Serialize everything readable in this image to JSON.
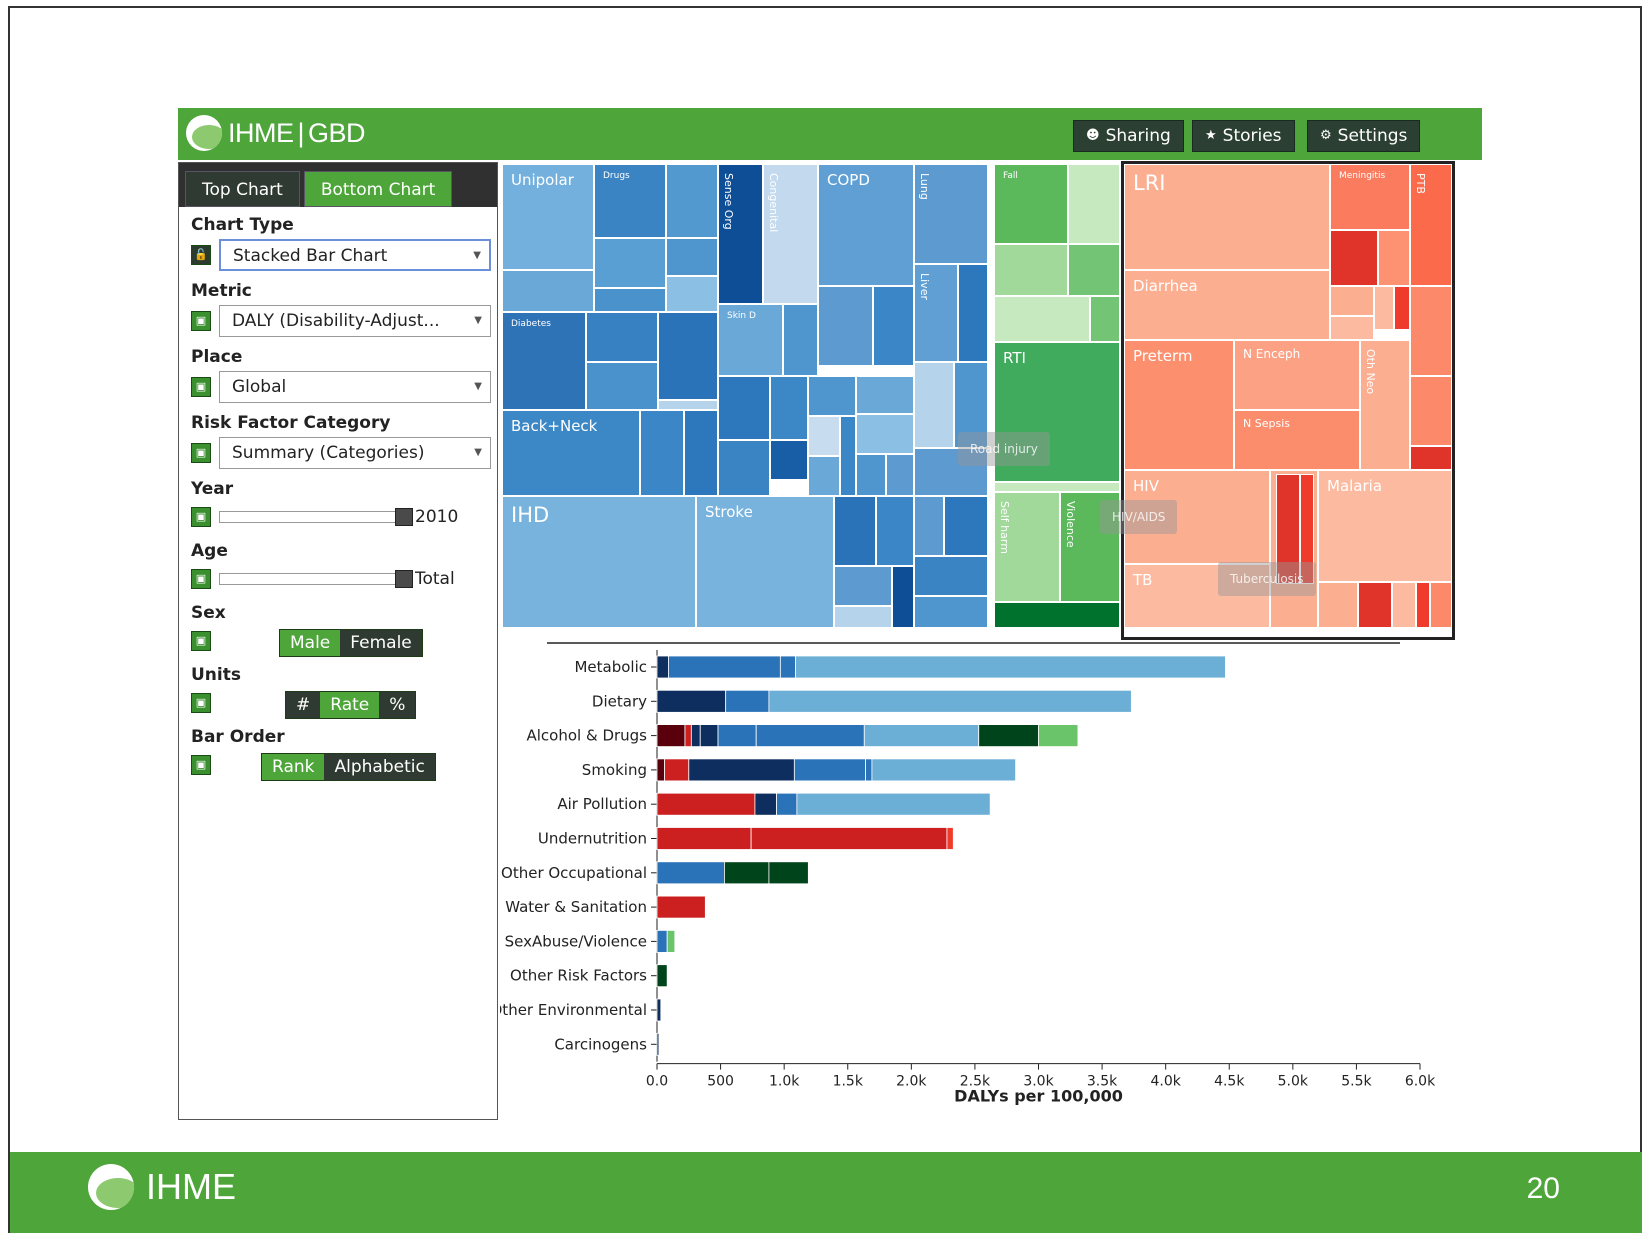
{
  "app": {
    "logo_left": "IHME",
    "logo_right": "GBD"
  },
  "header_buttons": [
    {
      "label": "Sharing",
      "icon": "user-icon"
    },
    {
      "label": "Stories",
      "icon": "star-icon"
    },
    {
      "label": "Settings",
      "icon": "gear-icon"
    }
  ],
  "sidebar": {
    "tabs": [
      {
        "label": "Top Chart",
        "active": false
      },
      {
        "label": "Bottom Chart",
        "active": true
      }
    ],
    "chart_type": {
      "label": "Chart Type",
      "value": "Stacked Bar Chart"
    },
    "metric": {
      "label": "Metric",
      "value": "DALY (Disability-Adjust..."
    },
    "place": {
      "label": "Place",
      "value": "Global"
    },
    "risk_factor_category": {
      "label": "Risk Factor Category",
      "value": "Summary (Categories)"
    },
    "year": {
      "label": "Year",
      "value": "2010"
    },
    "age": {
      "label": "Age",
      "value": "Total"
    },
    "sex": {
      "label": "Sex",
      "options": [
        "Male",
        "Female"
      ]
    },
    "units": {
      "label": "Units",
      "options": [
        "#",
        "Rate",
        "%"
      ],
      "selected": "Rate"
    },
    "bar_order": {
      "label": "Bar Order",
      "options": [
        "Rank",
        "Alphabetic"
      ],
      "selected": "Rank"
    }
  },
  "treemap": {
    "labels": {
      "unipolar": "Unipolar",
      "drugs": "Drugs",
      "sense_org": "Sense Org",
      "congenital": "Congenital",
      "copd": "COPD",
      "lung": "Lung",
      "liver": "Liver",
      "diabetes": "Diabetes",
      "skin_d": "Skin D",
      "back_neck": "Back+Neck",
      "ihd": "IHD",
      "stroke": "Stroke",
      "fall": "Fall",
      "rti": "RTI",
      "self_harm": "Self harm",
      "violence": "Violence",
      "lri": "LRI",
      "meningitis": "Meningitis",
      "ptb": "PTB",
      "diarrhea": "Diarrhea",
      "preterm": "Preterm",
      "n_enceph": "N Enceph",
      "n_sepsis": "N Sepsis",
      "oth_neo": "Oth Neo",
      "hiv": "HIV",
      "malaria": "Malaria",
      "tb": "TB"
    },
    "tooltips": {
      "road_injury": "Road injury",
      "hiv_aids": "HIV/AIDS",
      "tuberculosis": "Tuberculosis"
    }
  },
  "chart_data": {
    "type": "bar",
    "orientation": "horizontal",
    "stacked": true,
    "xlabel": "DALYs per 100,000",
    "xlim": [
      0,
      6000
    ],
    "xticks": [
      "0.0",
      "500",
      "1.0k",
      "1.5k",
      "2.0k",
      "2.5k",
      "3.0k",
      "3.5k",
      "4.0k",
      "4.5k",
      "5.0k",
      "5.5k",
      "6.0k"
    ],
    "categories": [
      "Metabolic",
      "Dietary",
      "Alcohol & Drugs",
      "Smoking",
      "Air Pollution",
      "Undernutrition",
      "Other Occupational",
      "Water & Sanitation",
      "SexAbuse/Violence",
      "Other Risk Factors",
      "Other Environmental",
      "Carcinogens"
    ],
    "segments": [
      [
        [
          90,
          "#0d2e5e"
        ],
        [
          880,
          "#2b73b8"
        ],
        [
          120,
          "#2b73b8"
        ],
        [
          3380,
          "#6baed6"
        ]
      ],
      [
        [
          540,
          "#0d2e5e"
        ],
        [
          340,
          "#2b73b8"
        ],
        [
          2850,
          "#6baed6"
        ]
      ],
      [
        [
          220,
          "#5a000d"
        ],
        [
          50,
          "#cc2020"
        ],
        [
          70,
          "#0d2e5e"
        ],
        [
          140,
          "#0d2e5e"
        ],
        [
          300,
          "#2b73b8"
        ],
        [
          850,
          "#2b73b8"
        ],
        [
          900,
          "#6baed6"
        ],
        [
          470,
          "#00441b"
        ],
        [
          310,
          "#6ac46a"
        ]
      ],
      [
        [
          60,
          "#5a000d"
        ],
        [
          190,
          "#cc2020"
        ],
        [
          830,
          "#0d2e5e"
        ],
        [
          560,
          "#2b73b8"
        ],
        [
          50,
          "#2b73b8"
        ],
        [
          1130,
          "#6baed6"
        ]
      ],
      [
        [
          770,
          "#cc2020"
        ],
        [
          170,
          "#0d2e5e"
        ],
        [
          160,
          "#2b73b8"
        ],
        [
          1520,
          "#6baed6"
        ]
      ],
      [
        [
          740,
          "#cc2020"
        ],
        [
          1540,
          "#cc2020"
        ],
        [
          50,
          "#ef3b2c"
        ]
      ],
      [
        [
          530,
          "#2b73b8"
        ],
        [
          350,
          "#00441b"
        ],
        [
          310,
          "#00441b"
        ]
      ],
      [
        [
          380,
          "#cc2020"
        ]
      ],
      [
        [
          80,
          "#2b73b8"
        ],
        [
          60,
          "#6ac46a"
        ]
      ],
      [
        [
          80,
          "#00441b"
        ]
      ],
      [
        [
          30,
          "#0d2e5e"
        ]
      ],
      [
        [
          15,
          "#0d2e5e"
        ]
      ]
    ]
  },
  "footer": {
    "logo": "IHME",
    "page_number": "20"
  }
}
